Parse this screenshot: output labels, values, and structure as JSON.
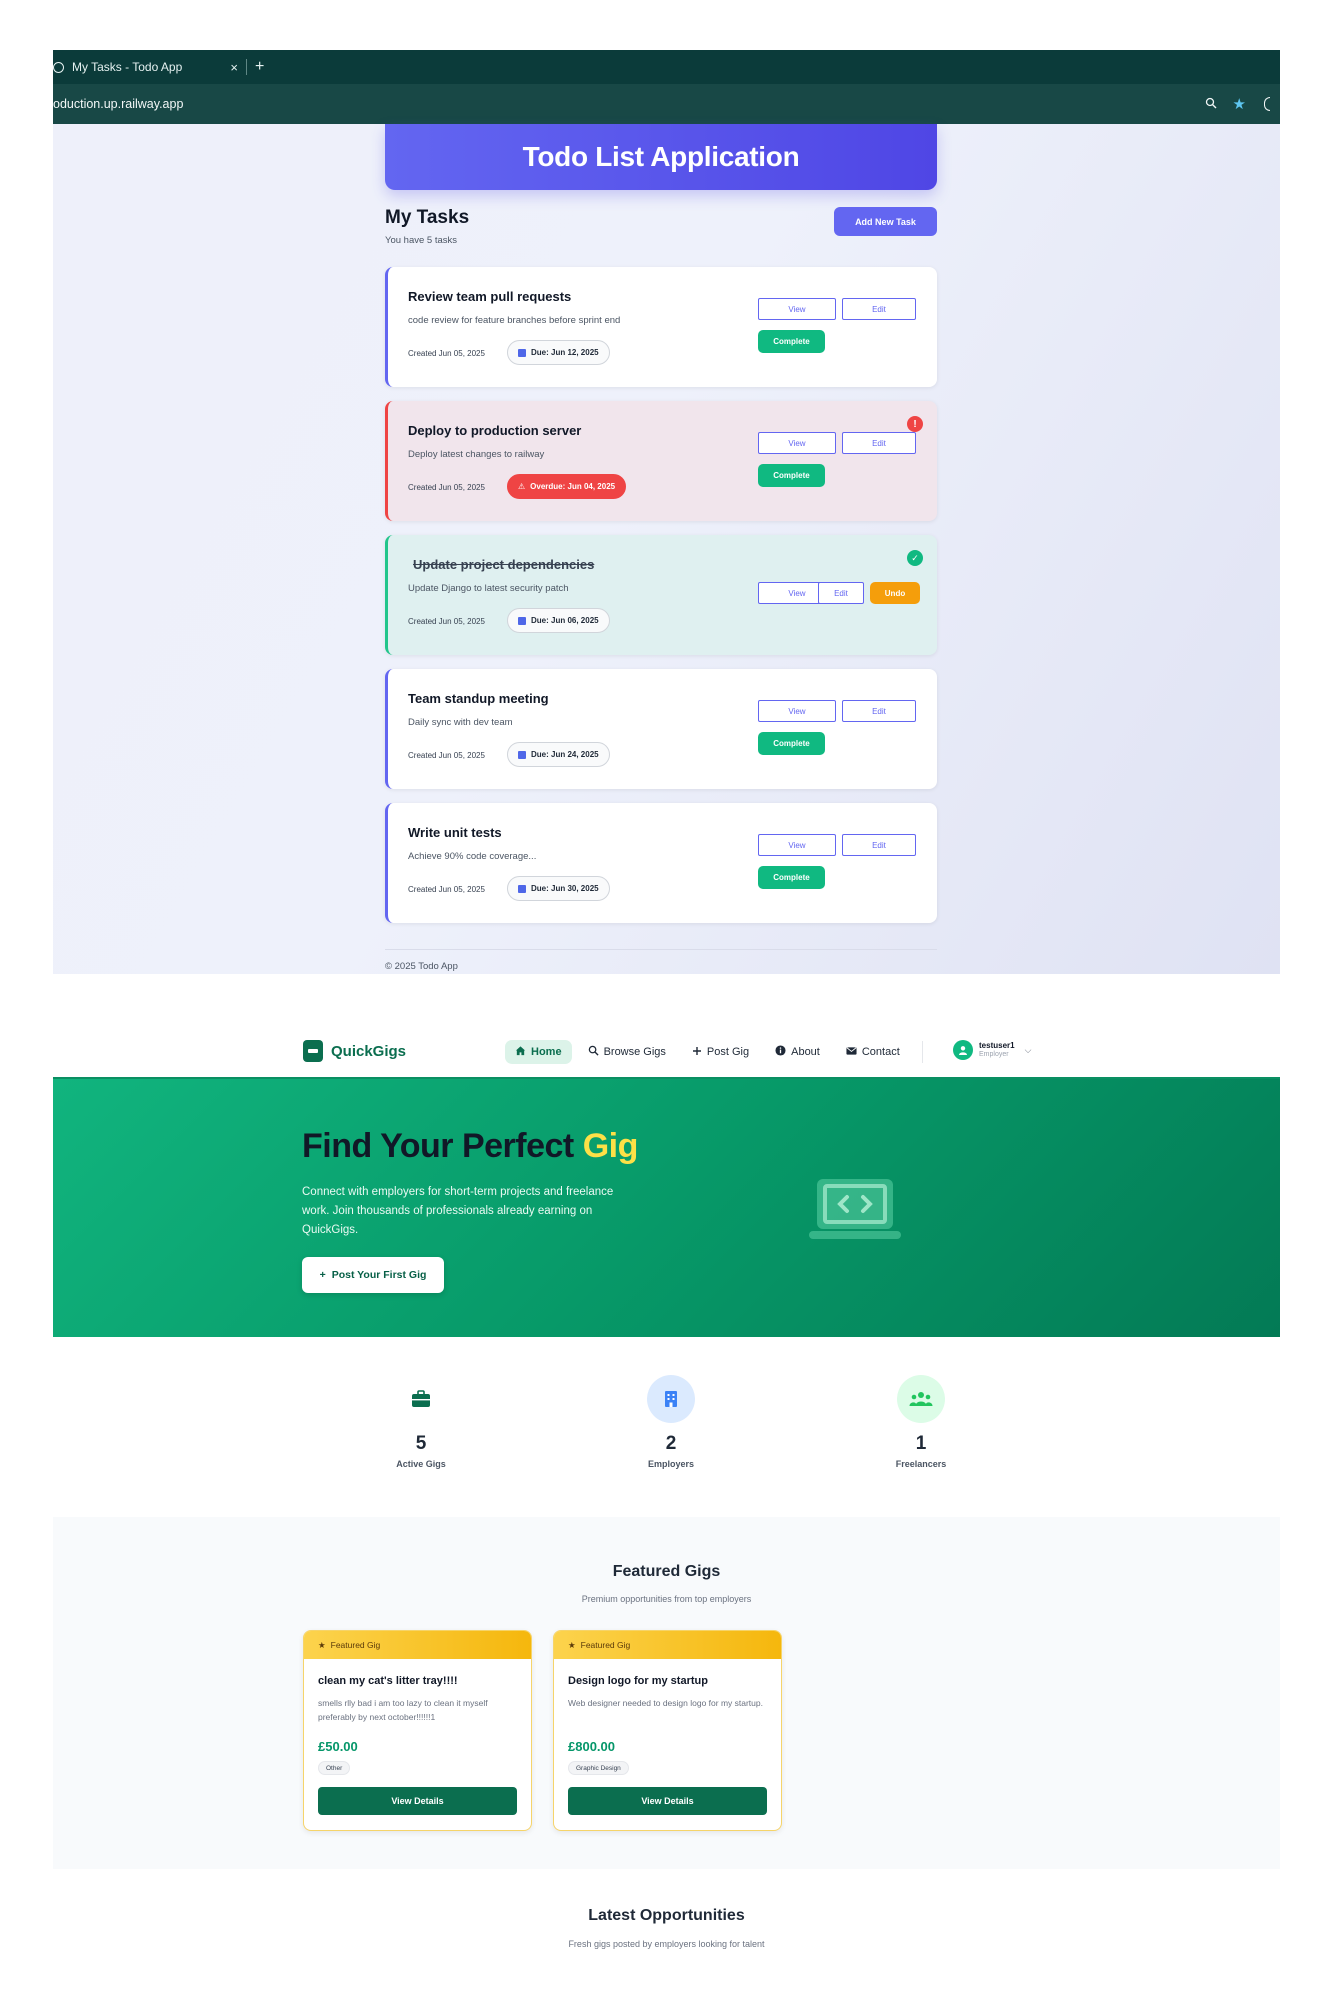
{
  "browser": {
    "tab_title": "My Tasks - Todo App",
    "tab_close": "×",
    "new_tab": "+",
    "url": "oduction.up.railway.app"
  },
  "todo": {
    "app_title": "Todo List Application",
    "heading": "My Tasks",
    "task_count": "You have 5 tasks",
    "add_button": "Add New Task",
    "view_label": "View",
    "edit_label": "Edit",
    "complete_label": "Complete",
    "undo_label": "Undo",
    "tasks": [
      {
        "title": "Review team pull requests",
        "description": "code review for feature branches before sprint end",
        "created": "Created Jun 05, 2025",
        "due": "Due: Jun 12, 2025",
        "status": "pending"
      },
      {
        "title": "Deploy to production server",
        "description": "Deploy latest changes to railway",
        "created": "Created Jun 05, 2025",
        "due": "Overdue: Jun 04, 2025",
        "status": "overdue",
        "badge": "!"
      },
      {
        "title": "Update project dependencies",
        "description": "Update Django to latest security patch",
        "created": "Created Jun 05, 2025",
        "due": "Due: Jun 06, 2025",
        "status": "completed",
        "badge": "✓"
      },
      {
        "title": "Team standup meeting",
        "description": "Daily sync with dev team",
        "created": "Created Jun 05, 2025",
        "due": "Due: Jun 24, 2025",
        "status": "pending"
      },
      {
        "title": "Write unit tests",
        "description": "Achieve 90% code coverage...",
        "created": "Created Jun 05, 2025",
        "due": "Due: Jun 30, 2025",
        "status": "pending"
      }
    ],
    "footer": "© 2025 Todo App"
  },
  "quickgigs": {
    "brand": "QuickGigs",
    "nav": [
      {
        "label": "Home",
        "icon": "home-icon",
        "active": true
      },
      {
        "label": "Browse Gigs",
        "icon": "search-icon",
        "active": false
      },
      {
        "label": "Post Gig",
        "icon": "plus-icon",
        "active": false
      },
      {
        "label": "About",
        "icon": "info-icon",
        "active": false
      },
      {
        "label": "Contact",
        "icon": "envelope-icon",
        "active": false
      }
    ],
    "user": {
      "name": "testuser1",
      "role": "Employer"
    },
    "hero": {
      "title_main": "Find Your Perfect ",
      "title_highlight": "Gig",
      "subtitle": "Connect with employers for short-term projects and freelance work. Join thousands of professionals already earning on QuickGigs.",
      "cta": "Post Your First Gig"
    },
    "stats": [
      {
        "value": "5",
        "label": "Active Gigs",
        "icon": "briefcase-icon"
      },
      {
        "value": "2",
        "label": "Employers",
        "icon": "building-icon"
      },
      {
        "value": "1",
        "label": "Freelancers",
        "icon": "users-icon"
      }
    ],
    "featured": {
      "title": "Featured Gigs",
      "subtitle": "Premium opportunities from top employers",
      "badge_label": "Featured Gig",
      "button_label": "View Details",
      "gigs": [
        {
          "title": "clean my cat's litter tray!!!!",
          "description": "smells rlly bad i am too lazy to clean it myself preferably by next october!!!!!!1",
          "price": "£50.00",
          "category": "Other"
        },
        {
          "title": "Design logo for my startup",
          "description": "Web designer needed to design logo for my startup.",
          "price": "£800.00",
          "category": "Graphic Design"
        }
      ]
    },
    "latest": {
      "title": "Latest Opportunities",
      "subtitle": "Fresh gigs posted by employers looking for talent"
    }
  },
  "colors": {
    "todo_accent": "#6366f1",
    "complete_green": "#10b981",
    "overdue_red": "#ef4444",
    "undo_orange": "#f59e0b",
    "qg_brand": "#0b6e4f",
    "hero_green": "#079968",
    "gig_highlight": "#fde047"
  }
}
